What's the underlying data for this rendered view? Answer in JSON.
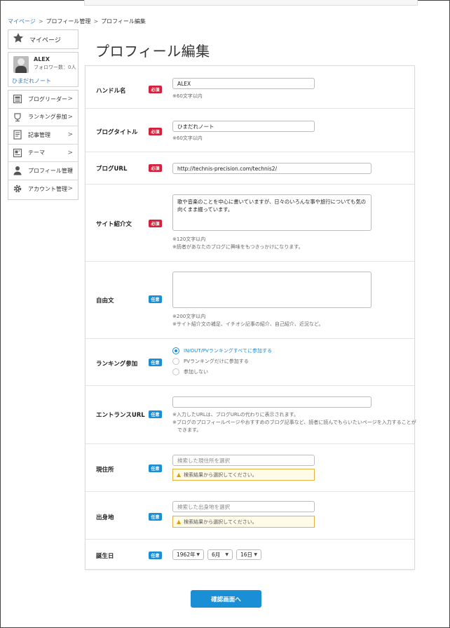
{
  "breadcrumb": {
    "items": [
      "マイページ",
      "プロフィール管理",
      "プロフィール編集"
    ],
    "separator": ">"
  },
  "sidebar": {
    "mypage": {
      "label": "マイページ",
      "icon": "star-icon"
    },
    "user": {
      "name": "ALEX",
      "followers": "フォロワー数：0人",
      "blog": "ひまだれノート"
    },
    "menu": [
      {
        "label": "ブログリーダー",
        "icon": "reader-icon"
      },
      {
        "label": "ランキング参加",
        "icon": "ranking-icon"
      },
      {
        "label": "記事管理",
        "icon": "article-icon"
      },
      {
        "label": "テーマ",
        "icon": "theme-icon"
      },
      {
        "label": "プロフィール管理",
        "icon": "profile-icon"
      },
      {
        "label": "アカウント管理",
        "icon": "gear-icon"
      }
    ],
    "chevron": ">"
  },
  "page": {
    "title": "プロフィール編集"
  },
  "badges": {
    "required": "必須",
    "optional": "任意"
  },
  "form": {
    "handle": {
      "label": "ハンドル名",
      "value": "ALEX",
      "note": "※60文字以内"
    },
    "blog_title": {
      "label": "ブログタイトル",
      "value": "ひまだれノート",
      "note": "※60文字以内"
    },
    "blog_url": {
      "label": "ブログURL",
      "value": "http://technis-precision.com/technis2/"
    },
    "site_intro": {
      "label": "サイト紹介文",
      "value": "歌や音楽のことを中心に書いていますが、日々のいろんな事や旅行についても気の向くまま綴っています。",
      "notes": [
        "※120文字以内",
        "※読者があなたのブログに興味をもつきっかけになります。"
      ]
    },
    "free_text": {
      "label": "自由文",
      "value": "",
      "notes": [
        "※200文字以内",
        "※サイト紹介文の補足、イチオシ記事の紹介、自己紹介、近況など。"
      ]
    },
    "ranking": {
      "label": "ランキング参加",
      "options": [
        "IN/OUT/PVランキングすべてに参加する",
        "PVランキングだけに参加する",
        "参加しない"
      ],
      "selected": 0
    },
    "entrance_url": {
      "label": "エントランスURL",
      "value": "",
      "notes": [
        "※入力したURLは、ブログURLの代わりに表示されます。",
        "※ブログのプロフィールページやおすすめのブログ記事など、読者に読んでもらいたいページを入力することが",
        "　できます。"
      ]
    },
    "residence": {
      "label": "現住所",
      "placeholder": "検索した現住所を選択",
      "warning": "検索結果から選択してください。"
    },
    "birthplace": {
      "label": "出身地",
      "placeholder": "検索した出身地を選択",
      "warning": "検索結果から選択してください。"
    },
    "birthday": {
      "label": "誕生日",
      "year": "1962年",
      "month": "6月",
      "day": "16日"
    }
  },
  "submit": {
    "label": "確認画面へ"
  },
  "colors": {
    "accent": "#1a8fd6",
    "required": "#d6213b",
    "link": "#3d7ab8",
    "warning_border": "#e3b341"
  }
}
